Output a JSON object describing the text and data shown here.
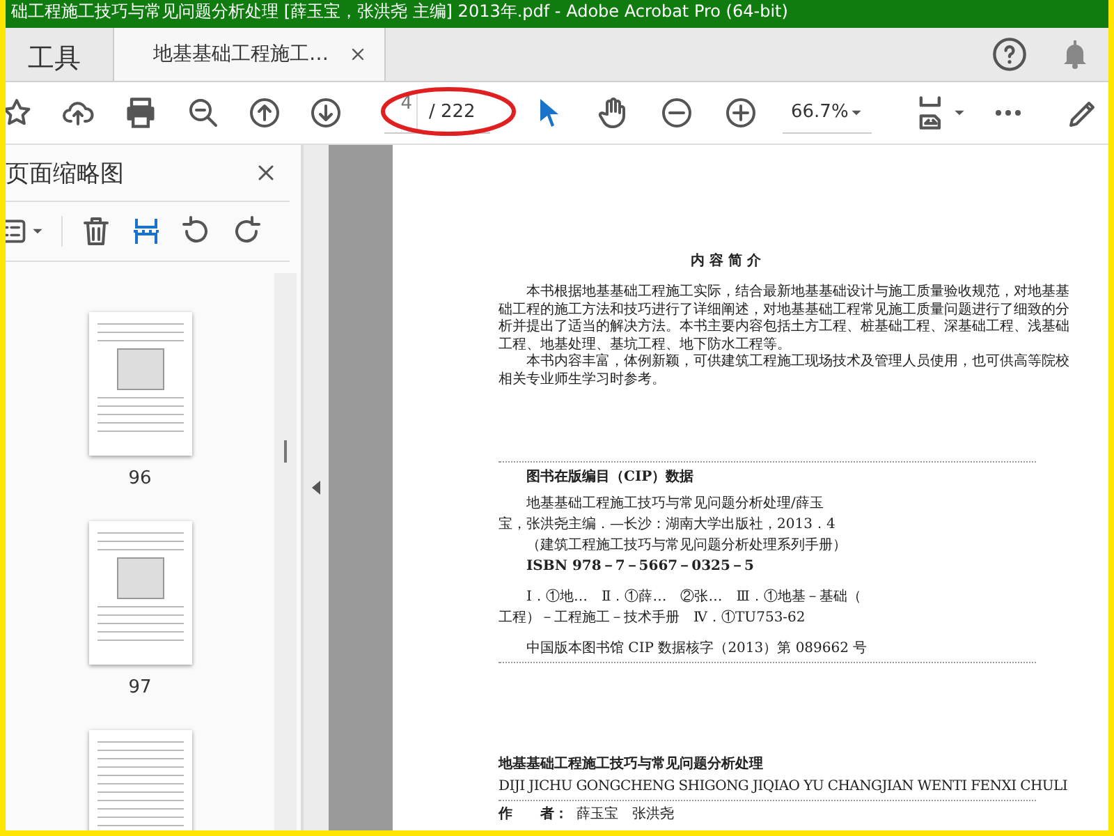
{
  "window": {
    "title": "础工程施工技巧与常见问题分析处理 [薛玉宝，张洪尧 主编] 2013年.pdf - Adobe Acrobat Pro (64-bit)"
  },
  "tabs": [
    {
      "label": "工具",
      "kind": "home",
      "selected": false
    },
    {
      "label": "地基基础工程施工…",
      "kind": "document",
      "selected": true
    }
  ],
  "toolbar": {
    "page_number": "4",
    "page_total": "/ 222",
    "zoom": "66.7%"
  },
  "thumbnail_panel": {
    "title": "页面缩略图",
    "thumbnails": [
      {
        "kind": "figure",
        "label": "96"
      },
      {
        "kind": "figure",
        "label": "97"
      },
      {
        "kind": "text"
      }
    ]
  },
  "document": {
    "heading": "内 容 简 介",
    "paragraphs": [
      "本书根据地基基础工程施工实际，结合最新地基基础设计与施工质量验收规范，对地基基础工程的施工方法和技巧进行了详细阐述，对地基基础工程常见施工质量问题进行了细致的分析并提出了适当的解决方法。本书主要内容包括土方工程、桩基础工程、深基础工程、浅基础工程、地基处理、基坑工程、地下防水工程等。",
      "本书内容丰富，体例新颖，可供建筑工程施工现场技术及管理人员使用，也可供高等院校相关专业师生学习时参考。"
    ],
    "cip": {
      "heading": "图书在版编目（CIP）数据",
      "groups": [
        [
          {
            "text": "地基基础工程施工技巧与常见问题分析处理/薛玉",
            "indent": true,
            "bold": false
          },
          {
            "text": "宝，张洪尧主编．—长沙：湖南大学出版社，2013．4",
            "indent": false,
            "bold": false
          },
          {
            "text": "（建筑工程施工技巧与常见问题分析处理系列手册）",
            "indent": true,
            "bold": false
          },
          {
            "text": "ISBN 978－7－5667－0325－5",
            "indent": true,
            "bold": true
          }
        ],
        [
          {
            "text": "Ⅰ．①地…　Ⅱ．①薛…　②张…　Ⅲ．①地基－基础（",
            "indent": true,
            "bold": false
          },
          {
            "text": "工程）－工程施工－技术手册　Ⅳ．①TU753-62",
            "indent": false,
            "bold": false
          }
        ],
        [
          {
            "text": "中国版本图书馆 CIP 数据核字（2013）第 089662 号",
            "indent": true,
            "bold": false
          }
        ]
      ]
    },
    "book_title": "地基基础工程施工技巧与常见问题分析处理",
    "pinyin": "DIJI JICHU GONGCHENG SHIGONG JIQIAO YU CHANGJIAN WENTI FENXI CHULI",
    "author_label": "作　　者：",
    "author": "薛玉宝　张洪尧"
  }
}
